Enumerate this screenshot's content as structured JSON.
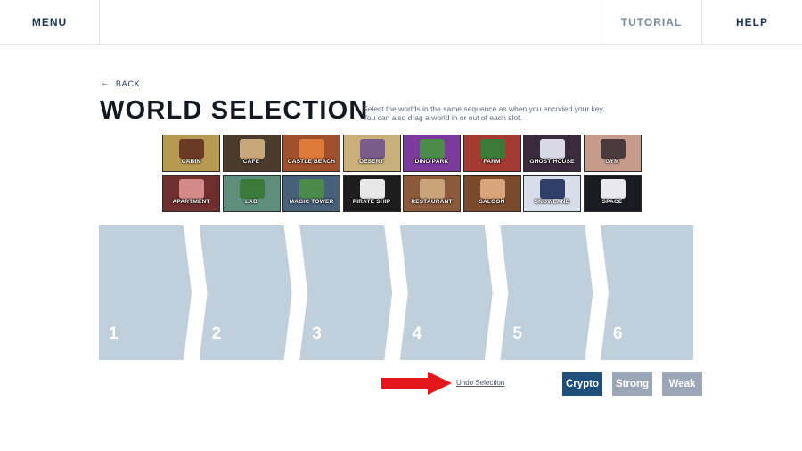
{
  "nav": {
    "menu": "MENU",
    "tutorial": "TUTORIAL",
    "help": "HELP"
  },
  "back": {
    "arrow": "←",
    "label": "BACK"
  },
  "page": {
    "title": "WORLD SELECTION",
    "instructions_line1": "Select the worlds in the same sequence as when you encoded your key.",
    "instructions_line2": "You can also drag a world in or out of each slot."
  },
  "worlds": [
    {
      "label": "CABIN",
      "bg": "#b79a52",
      "accent": "#6b3a24"
    },
    {
      "label": "CAFE",
      "bg": "#4a3b2d",
      "accent": "#c8a77a"
    },
    {
      "label": "CASTLE BEACH",
      "bg": "#a1502d",
      "accent": "#e07a3a"
    },
    {
      "label": "DESERT",
      "bg": "#c9b07a",
      "accent": "#7a5b8a"
    },
    {
      "label": "DINO PARK",
      "bg": "#7c3b9c",
      "accent": "#4c8b4a"
    },
    {
      "label": "FARM",
      "bg": "#a33b32",
      "accent": "#3c7a3a"
    },
    {
      "label": "GHOST HOUSE",
      "bg": "#3a2c3c",
      "accent": "#d9d9e6"
    },
    {
      "label": "GYM",
      "bg": "#c79b8c",
      "accent": "#4b3a3c"
    },
    {
      "label": "APARTMENT",
      "bg": "#6f2f2f",
      "accent": "#d58a8a"
    },
    {
      "label": "LAB",
      "bg": "#5f8f7c",
      "accent": "#3b7a3a"
    },
    {
      "label": "MAGIC TOWER",
      "bg": "#48607a",
      "accent": "#4b8a4a"
    },
    {
      "label": "PIRATE SHIP",
      "bg": "#1d1d1d",
      "accent": "#e8e8e8"
    },
    {
      "label": "RESTAURANT",
      "bg": "#8a5a3a",
      "accent": "#c9a47a"
    },
    {
      "label": "SALOON",
      "bg": "#7a4a2d",
      "accent": "#d9a47a"
    },
    {
      "label": "SNOWLAND",
      "bg": "#d7deea",
      "accent": "#2f3f6a"
    },
    {
      "label": "SPACE",
      "bg": "#1a1a22",
      "accent": "#e8e8ee"
    }
  ],
  "slots": [
    "1",
    "2",
    "3",
    "4",
    "5",
    "6"
  ],
  "actions": {
    "undo": "Undo Selection",
    "crypto": "Crypto",
    "strong": "Strong",
    "weak": "Weak"
  },
  "colors": {
    "slot": "#bfcfdc",
    "primary": "#1f4f7a",
    "inactive": "#9ba7b6",
    "arrow": "#e3171b"
  }
}
